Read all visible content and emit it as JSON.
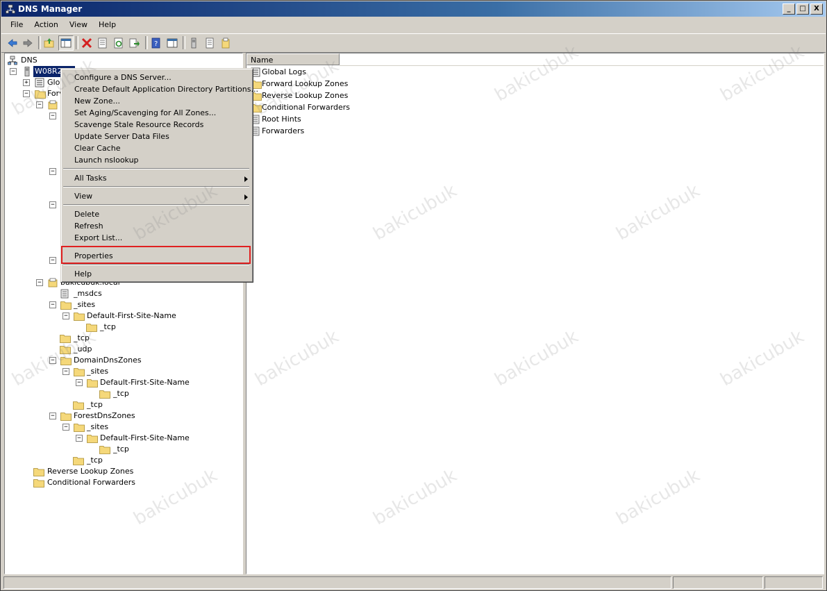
{
  "window": {
    "title": "DNS Manager",
    "controls": [
      "_",
      "□",
      "X"
    ]
  },
  "menubar": [
    "File",
    "Action",
    "View",
    "Help"
  ],
  "tree": {
    "root": "DNS",
    "server": "W08R2DC",
    "nodes": {
      "global_logs": "Glob",
      "forward": "Forv",
      "bakicubuk_local": "bakicubuk.local",
      "msdcs": "_msdcs",
      "sites": "_sites",
      "default_first_site": "Default-First-Site-Name",
      "tcp": "_tcp",
      "udp": "_udp",
      "domain_dns_zones": "DomainDnsZones",
      "forest_dns_zones": "ForestDnsZones",
      "reverse_lookup_zones": "Reverse Lookup Zones",
      "conditional_forwarders": "Conditional Forwarders"
    }
  },
  "list": {
    "column": "Name",
    "items": [
      "Global Logs",
      "Forward Lookup Zones",
      "Reverse Lookup Zones",
      "Conditional Forwarders",
      "Root Hints",
      "Forwarders"
    ]
  },
  "context_menu": {
    "items": [
      "Configure a DNS Server...",
      "Create Default Application Directory Partitions...",
      "New Zone...",
      "Set Aging/Scavenging for All Zones...",
      "Scavenge Stale Resource Records",
      "Update Server Data Files",
      "Clear Cache",
      "Launch nslookup"
    ],
    "all_tasks": "All Tasks",
    "view": "View",
    "delete": "Delete",
    "refresh": "Refresh",
    "export_list": "Export List...",
    "properties": "Properties",
    "help": "Help",
    "highlight_color": "#e02020"
  },
  "watermark": "bakicubuk"
}
